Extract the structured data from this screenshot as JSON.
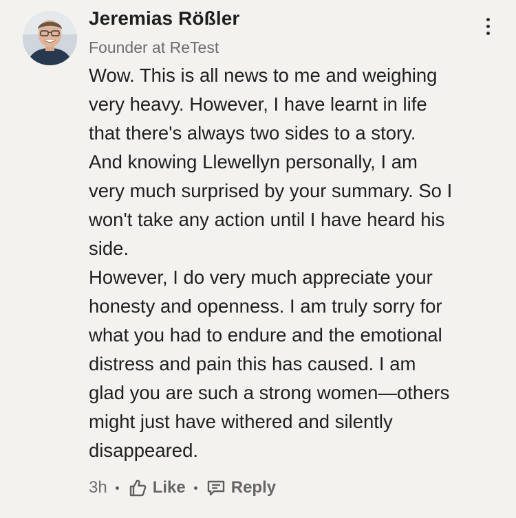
{
  "comment": {
    "author": {
      "name": "Jeremias Rößler",
      "headline": "Founder at ReTest"
    },
    "body_lines": [
      "Wow. This is all news to me and weighing",
      "very heavy. However, I have learnt in life",
      "that there's always two sides to a story.",
      "And knowing Llewellyn personally, I am",
      "very much surprised by your summary. So I",
      "won't take any action until I have heard his",
      "side.",
      "However, I do very much appreciate your",
      "honesty and openness. I am truly sorry for",
      "what you had to endure and the emotional",
      "distress and pain this has caused. I am",
      "glad you are such a strong women—others",
      "might just have withered and silently",
      "disappeared."
    ],
    "timestamp": "3h",
    "actions": {
      "like_label": "Like",
      "reply_label": "Reply"
    }
  },
  "icons": {
    "more": "more-vertical-icon",
    "like": "thumbs-up-icon",
    "reply": "comment-icon"
  },
  "colors": {
    "background": "#f3f2ef",
    "text": "#1f1f1f",
    "muted": "#6d6d6d"
  }
}
